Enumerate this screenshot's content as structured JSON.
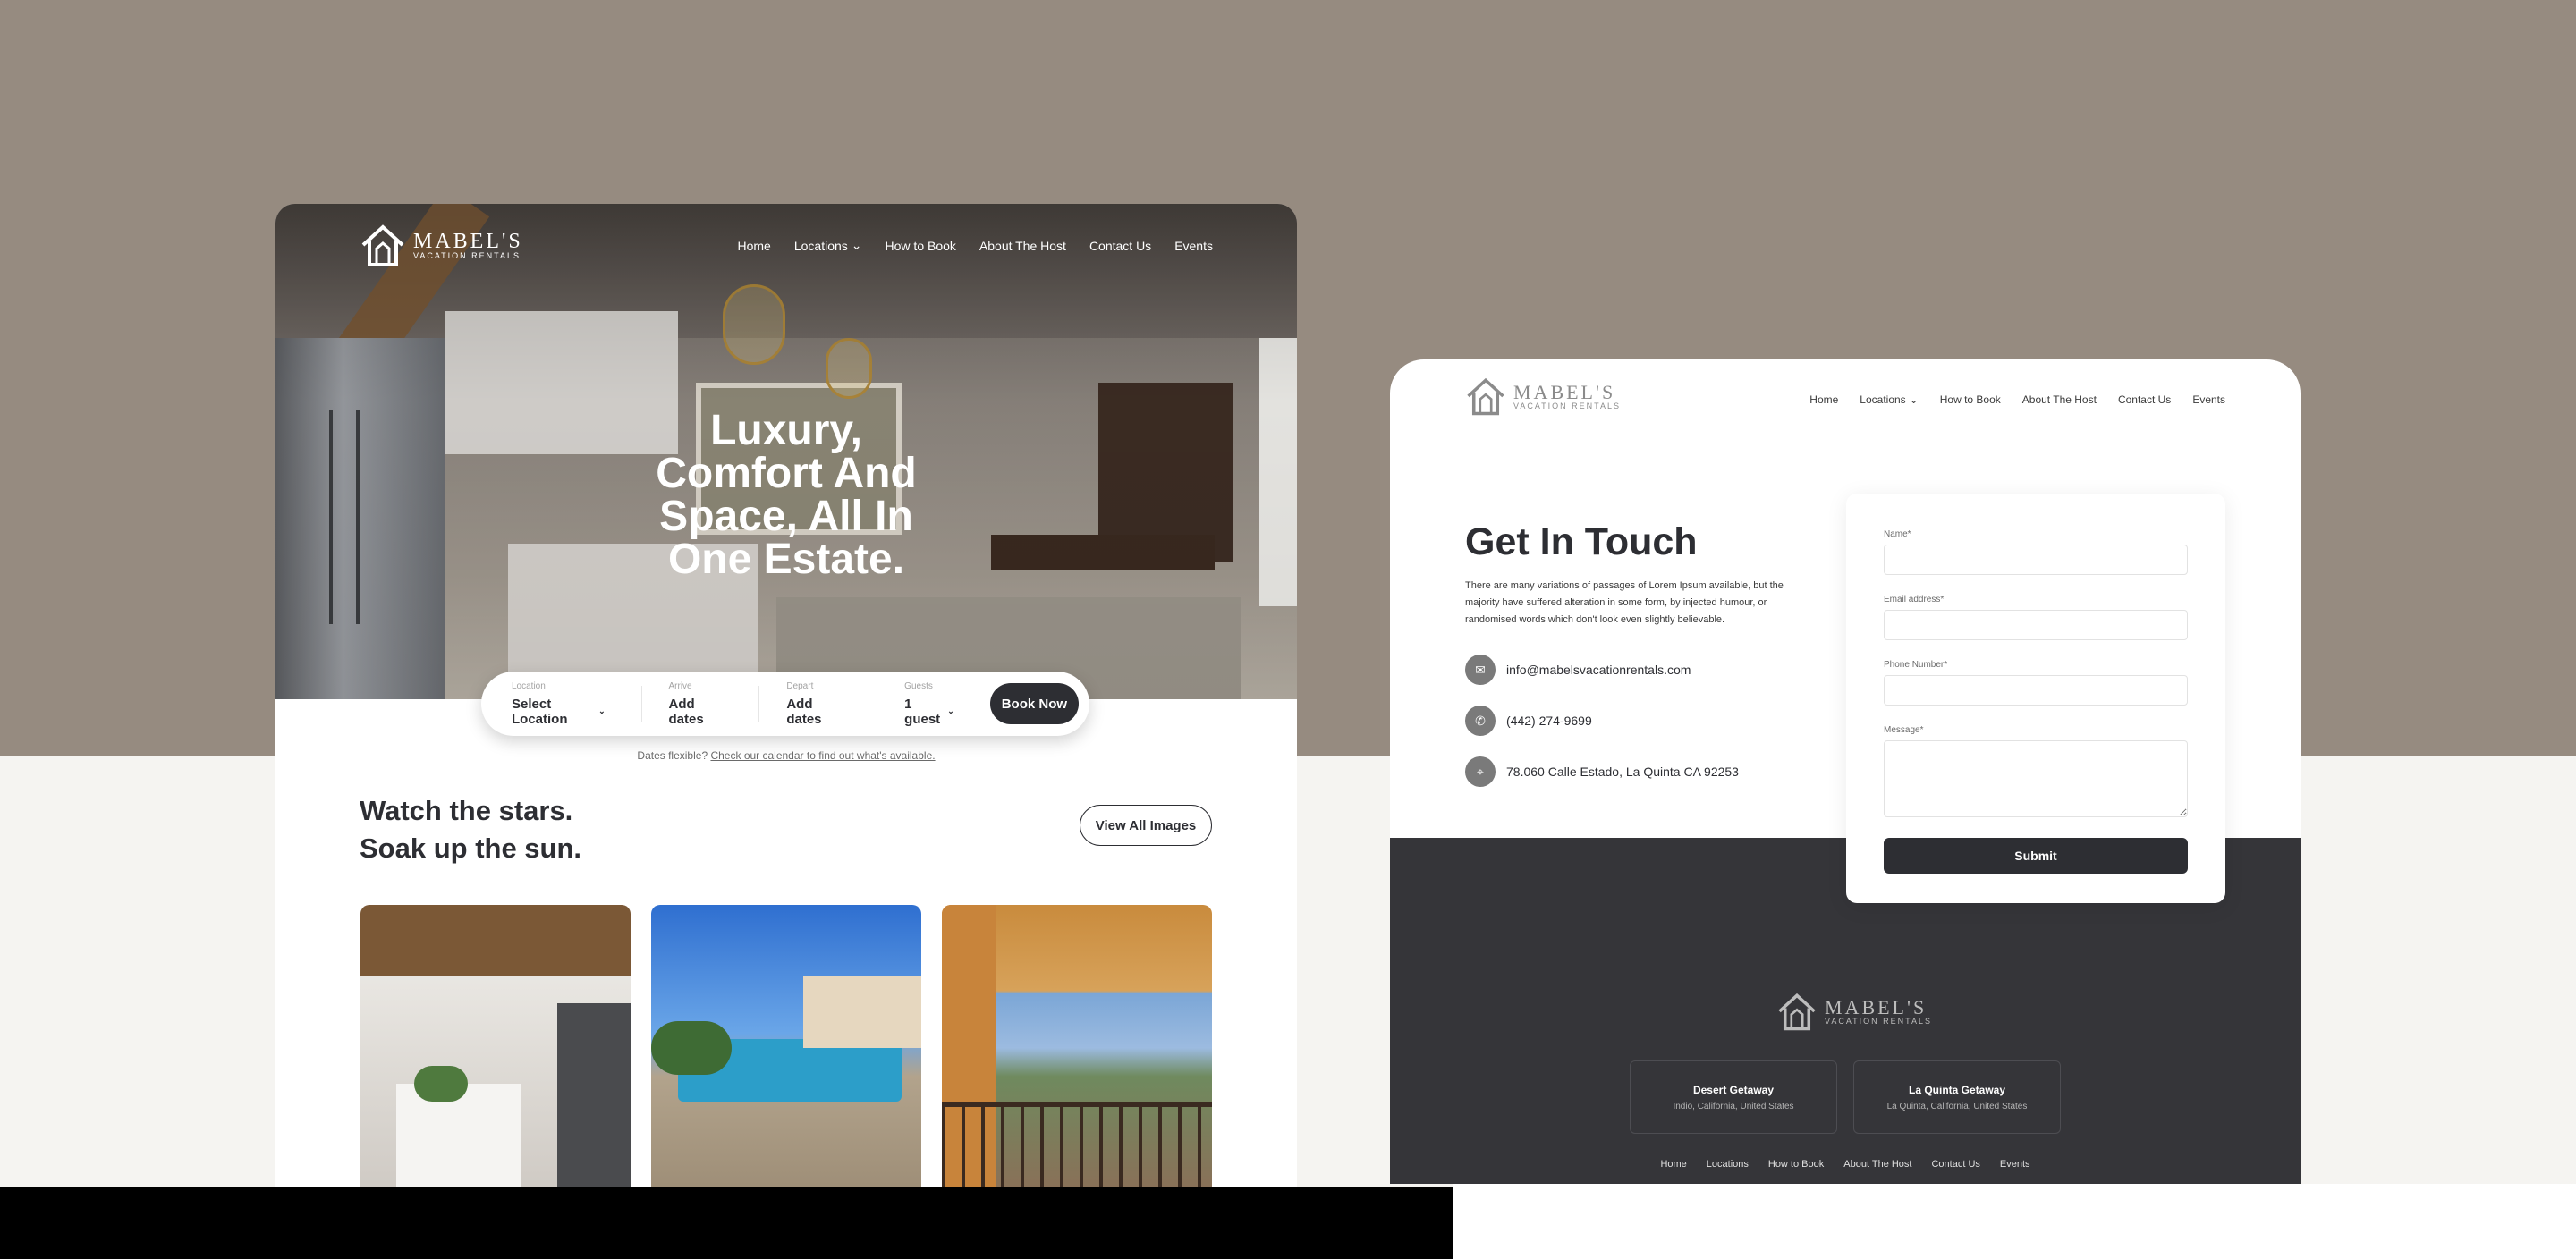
{
  "brand": {
    "name": "MABEL'S",
    "tagline": "VACATION RENTALS"
  },
  "nav": {
    "items": [
      "Home",
      "Locations",
      "How to Book",
      "About The Host",
      "Contact Us",
      "Events"
    ]
  },
  "hero": {
    "title": "Luxury, Comfort And Space, All In One Estate."
  },
  "search": {
    "location": {
      "label": "Location",
      "value": "Select Location"
    },
    "arrive": {
      "label": "Arrive",
      "value": "Add dates"
    },
    "depart": {
      "label": "Depart",
      "value": "Add dates"
    },
    "guests": {
      "label": "Guests",
      "value": "1 guest"
    },
    "book_button": "Book Now"
  },
  "flex_note": {
    "text": "Dates flexible?",
    "link": "Check our calendar to find out what's available."
  },
  "gallery": {
    "title_line1": "Watch the stars.",
    "title_line2": "Soak up the sun.",
    "view_all": "View All Images"
  },
  "contact": {
    "title": "Get In Touch",
    "description": "There are many variations of passages of Lorem Ipsum available, but the majority have suffered alteration in some form, by injected humour, or randomised words which don't look even slightly believable.",
    "email": "info@mabelsvacationrentals.com",
    "phone": "(442) 274-9699",
    "address": "78.060 Calle Estado, La Quinta CA 92253"
  },
  "form": {
    "name_label": "Name*",
    "email_label": "Email address*",
    "phone_label": "Phone Number*",
    "message_label": "Message*",
    "submit": "Submit"
  },
  "footer": {
    "locations": [
      {
        "title": "Desert Getaway",
        "subtitle": "Indio, California, United States"
      },
      {
        "title": "La Quinta Getaway",
        "subtitle": "La Quinta, California, United States"
      }
    ]
  },
  "colors": {
    "page_top": "#968b80",
    "page_bottom": "#f5f4f1",
    "dark": "#2d2e33",
    "footer": "#353539"
  }
}
